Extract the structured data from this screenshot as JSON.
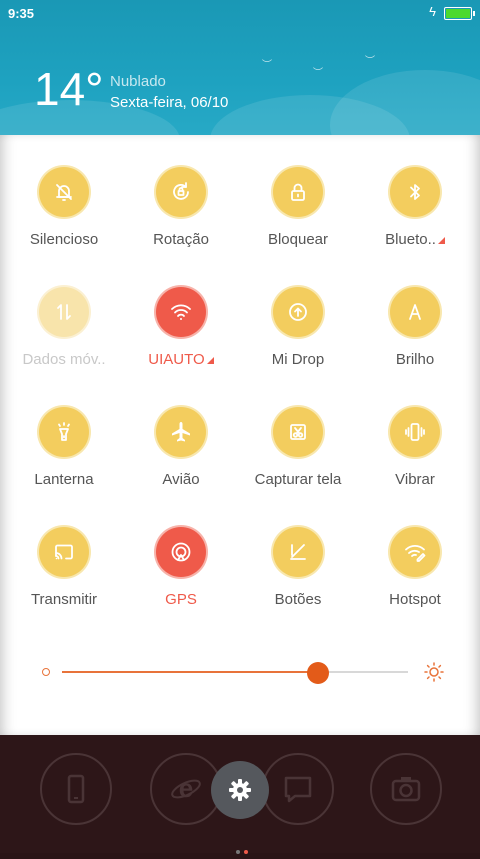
{
  "status": {
    "time": "9:35",
    "battery_level": 1.0,
    "charging_icon": "bolt-icon"
  },
  "weather": {
    "temperature": "14°",
    "condition": "Nublado",
    "date": "Sexta-feira, 06/10"
  },
  "tiles": [
    {
      "label": "Silencioso",
      "icon": "bell-off-icon",
      "state": "on"
    },
    {
      "label": "Rotação",
      "icon": "rotation-lock-icon",
      "state": "on"
    },
    {
      "label": "Bloquear",
      "icon": "lock-icon",
      "state": "on"
    },
    {
      "label": "Blueto..",
      "icon": "bluetooth-icon",
      "state": "on",
      "expand": true
    },
    {
      "label": "Dados móv..",
      "icon": "mobile-data-icon",
      "state": "disabled"
    },
    {
      "label": "UIAUTO",
      "icon": "wifi-icon",
      "state": "active",
      "expand": true
    },
    {
      "label": "Mi Drop",
      "icon": "mi-drop-icon",
      "state": "on"
    },
    {
      "label": "Brilho",
      "icon": "auto-brightness-icon",
      "state": "on"
    },
    {
      "label": "Lanterna",
      "icon": "flashlight-icon",
      "state": "on"
    },
    {
      "label": "Avião",
      "icon": "airplane-icon",
      "state": "on"
    },
    {
      "label": "Capturar tela",
      "icon": "screenshot-icon",
      "state": "on"
    },
    {
      "label": "Vibrar",
      "icon": "vibrate-icon",
      "state": "on"
    },
    {
      "label": "Transmitir",
      "icon": "cast-icon",
      "state": "on"
    },
    {
      "label": "GPS",
      "icon": "gps-icon",
      "state": "active"
    },
    {
      "label": "Botões",
      "icon": "buttons-off-icon",
      "state": "on"
    },
    {
      "label": "Hotspot",
      "icon": "hotspot-icon",
      "state": "on"
    }
  ],
  "brightness": {
    "value": 0.74
  },
  "dock": {
    "apps": [
      "phone-icon",
      "browser-icon",
      "messages-icon",
      "camera-icon"
    ],
    "settings_icon": "settings-gear-icon",
    "page_count": 2,
    "current_page": 2
  },
  "colors": {
    "accent": "#ef5a4a",
    "tile": "#f3cd5e",
    "slider": "#e35b19",
    "header": "#1ea2c0"
  }
}
